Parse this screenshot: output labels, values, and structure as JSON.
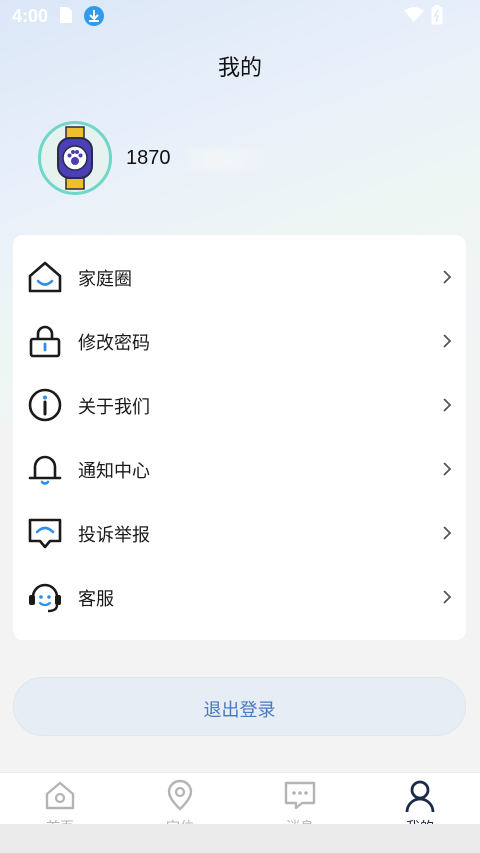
{
  "status_bar": {
    "time": "4:00",
    "icons": [
      "sim-icon",
      "download-icon",
      "wifi-icon",
      "battery-icon"
    ]
  },
  "header": {
    "title": "我的"
  },
  "profile": {
    "phone_visible": "1870",
    "avatar_icon": "watch-paw-icon"
  },
  "menu": {
    "items": [
      {
        "label": "家庭圈",
        "icon": "home-icon"
      },
      {
        "label": "修改密码",
        "icon": "lock-icon"
      },
      {
        "label": "关于我们",
        "icon": "info-icon"
      },
      {
        "label": "通知中心",
        "icon": "bell-icon"
      },
      {
        "label": "投诉举报",
        "icon": "report-icon"
      },
      {
        "label": "客服",
        "icon": "headset-icon"
      }
    ]
  },
  "logout": {
    "label": "退出登录"
  },
  "tabbar": {
    "tabs": [
      {
        "label": "首页",
        "icon": "home-tab-icon",
        "active": false
      },
      {
        "label": "定位",
        "icon": "location-icon",
        "active": false
      },
      {
        "label": "消息",
        "icon": "message-icon",
        "active": false
      },
      {
        "label": "我的",
        "icon": "person-icon",
        "active": true
      }
    ]
  },
  "colors": {
    "accent": "#4a78c2",
    "icon_blue": "#2f8fe8",
    "active_tab": "#1b2a4a",
    "inactive_tab": "#b4b4b4",
    "avatar_ring": "#6fd6c8"
  }
}
